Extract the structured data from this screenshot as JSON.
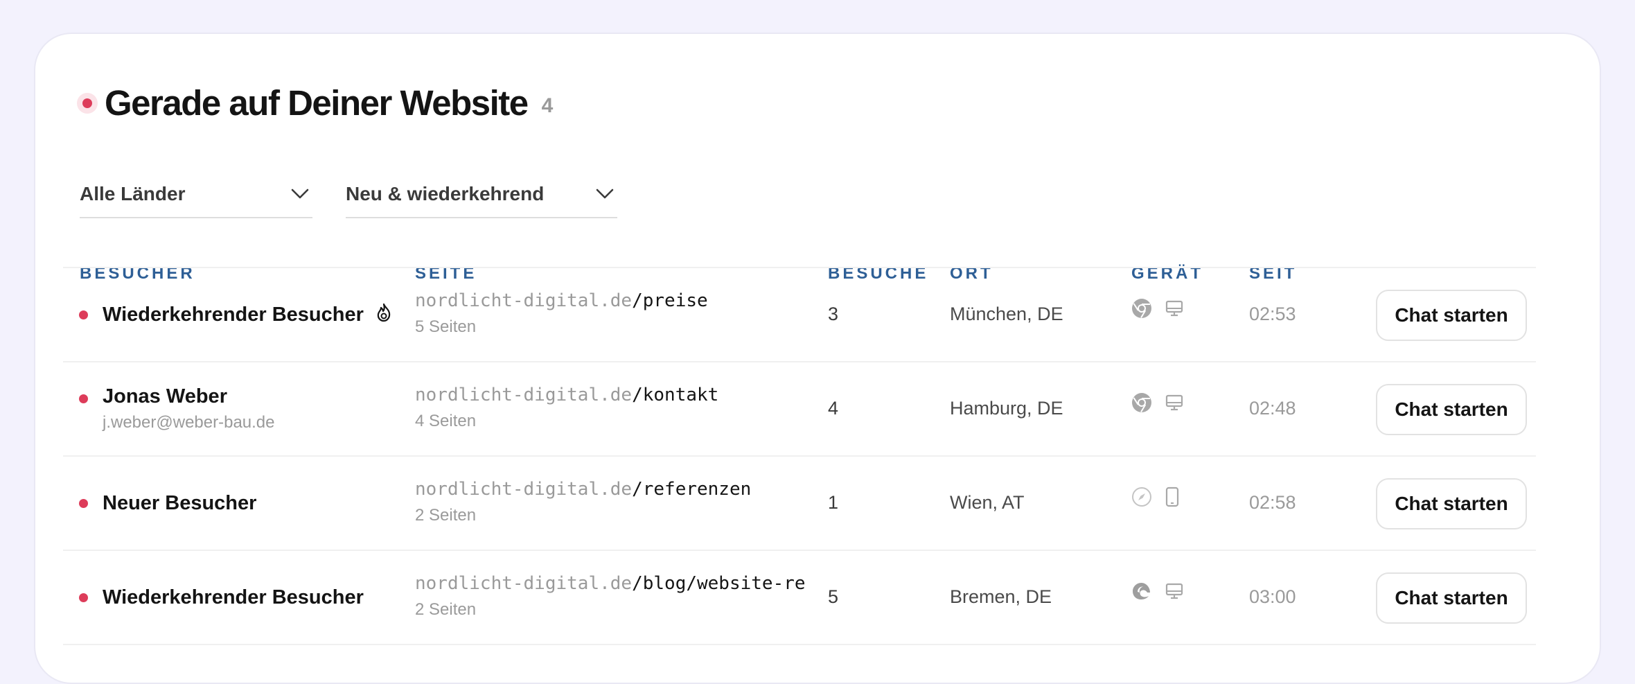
{
  "header": {
    "title": "Gerade auf Deiner Website",
    "count": "4"
  },
  "filters": {
    "country": "Alle Länder",
    "visitor_type": "Neu & wiederkehrend"
  },
  "columns": {
    "visitor": "BESUCHER",
    "page": "SEITE",
    "visits": "BESUCHE",
    "location": "ORT",
    "device": "GERÄT",
    "since": "SEIT"
  },
  "rows": [
    {
      "name": "Wiederkehrender Besucher",
      "sub": "",
      "flame": true,
      "domain": "nordlicht-digital.de",
      "path": "/preise",
      "pages": "5 Seiten",
      "visits": "3",
      "location": "München, DE",
      "browser_icon": "chrome-icon",
      "device_icon": "desktop-icon",
      "since": "02:53",
      "action": "Chat starten"
    },
    {
      "name": "Jonas Weber",
      "sub": "j.weber@weber-bau.de",
      "flame": false,
      "domain": "nordlicht-digital.de",
      "path": "/kontakt",
      "pages": "4 Seiten",
      "visits": "4",
      "location": "Hamburg, DE",
      "browser_icon": "chrome-icon",
      "device_icon": "desktop-icon",
      "since": "02:48",
      "action": "Chat starten"
    },
    {
      "name": "Neuer Besucher",
      "sub": "",
      "flame": false,
      "domain": "nordlicht-digital.de",
      "path": "/referenzen",
      "pages": "2 Seiten",
      "visits": "1",
      "location": "Wien, AT",
      "browser_icon": "safari-icon",
      "device_icon": "mobile-icon",
      "since": "02:58",
      "action": "Chat starten"
    },
    {
      "name": "Wiederkehrender Besucher",
      "sub": "",
      "flame": false,
      "domain": "nordlicht-digital.de",
      "path": "/blog/website-rel…",
      "pages": "2 Seiten",
      "visits": "5",
      "location": "Bremen, DE",
      "browser_icon": "edge-icon",
      "device_icon": "desktop-icon",
      "since": "03:00",
      "action": "Chat starten"
    }
  ],
  "colors": {
    "accent_live": "#dd3c5a",
    "column_header": "#2e5f96",
    "background": "#f3f2fd"
  }
}
